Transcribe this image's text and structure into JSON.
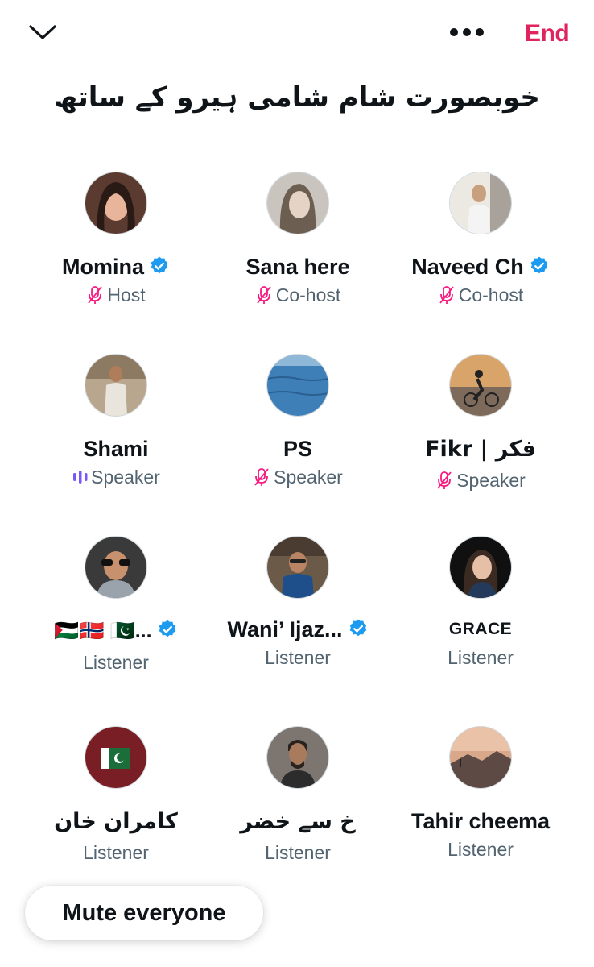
{
  "topbar": {
    "collapse_icon": "chevron-down-icon",
    "more_icon": "more-horizontal-icon",
    "end_label": "End",
    "accent": "#e0245e"
  },
  "space": {
    "title": "خوبصورت شام شامی ہیرو کے ساتھ"
  },
  "participants": [
    {
      "name": "Momina",
      "verified": true,
      "role": "Host",
      "role_icon": "mic-muted-icon"
    },
    {
      "name": "Sana here",
      "verified": false,
      "role": "Co-host",
      "role_icon": "mic-muted-icon"
    },
    {
      "name": "Naveed Ch",
      "verified": true,
      "role": "Co-host",
      "role_icon": "mic-muted-icon"
    },
    {
      "name": "Shami",
      "verified": false,
      "role": "Speaker",
      "role_icon": "speaking-bars-icon"
    },
    {
      "name": "PS",
      "verified": false,
      "role": "Speaker",
      "role_icon": "mic-muted-icon"
    },
    {
      "name": "Fikr | فکر",
      "verified": false,
      "role": "Speaker",
      "role_icon": "mic-muted-icon"
    },
    {
      "name": "🇵🇸🇳🇴 🇵🇰...",
      "verified": true,
      "role": "Listener",
      "role_icon": ""
    },
    {
      "name": "Wani’ Ijaz...",
      "verified": true,
      "role": "Listener",
      "role_icon": ""
    },
    {
      "name": "GRACE",
      "verified": false,
      "role": "Listener",
      "role_icon": ""
    },
    {
      "name": "کامران خان",
      "verified": false,
      "role": "Listener",
      "role_icon": ""
    },
    {
      "name": "خ سے خضر",
      "verified": false,
      "role": "Listener",
      "role_icon": ""
    },
    {
      "name": "Tahir cheema",
      "verified": false,
      "role": "Listener",
      "role_icon": ""
    }
  ],
  "footer": {
    "mute_label": "Mute everyone"
  },
  "colors": {
    "verified_blue": "#1d9bf0",
    "muted_mic_pink": "#f91880",
    "speaking_purple": "#7856ff",
    "secondary_text": "#536471"
  }
}
